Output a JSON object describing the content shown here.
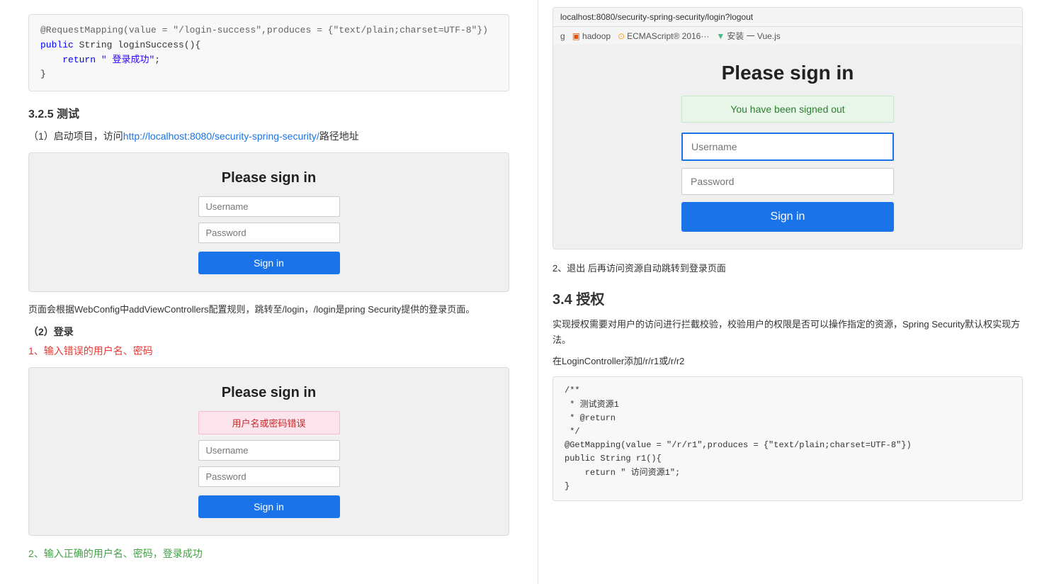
{
  "left": {
    "code_block_1": {
      "line1": "@RequestMapping(value = \"/login-success\",produces = {\"text/plain;charset=UTF-8\"})",
      "line2": "public String loginSuccess(){",
      "line3": "    return \" 登录成功\";",
      "line4": "}"
    },
    "section_325": "3.2.5 测试",
    "para1_prefix": "（1）启动项目，访问",
    "para1_link": "http://localhost:8080/security-spring-security/",
    "para1_suffix": "路径地址",
    "login_box_1": {
      "title": "Please sign in",
      "username_placeholder": "Username",
      "password_placeholder": "Password",
      "sign_in_btn": "Sign in"
    },
    "note_1": "页面会根据WebConfig中addViewControllers配置规则，跳转至/login，/login是pring Security提供的登录页面。",
    "sub_label_2": "（2）登录",
    "red_label_1": "1、输入错误的用户名、密码",
    "login_box_2": {
      "title": "Please sign in",
      "error_msg": "用户名或密码错误",
      "username_placeholder": "Username",
      "password_placeholder": "Password",
      "sign_in_btn": "Sign in"
    },
    "green_label_bottom": "2、输入正确的用户名、密码，登录成功"
  },
  "right": {
    "browser_url": "localhost:8080/security-spring-security/login?logout",
    "bookmarks": [
      "g",
      "hadoop",
      "ECMAScript® 2016···",
      "安装 一 Vue.js"
    ],
    "browser_login": {
      "title": "Please sign in",
      "signed_out_msg": "You have been signed out",
      "username_placeholder": "Username",
      "password_placeholder": "Password",
      "sign_in_btn": "Sign in"
    },
    "note_2": "2、退出 后再访问资源自动跳转到登录页面",
    "section_34": "3.4 授权",
    "para_auth": "实现授权需要对用户的访问进行拦截校验，校验用户的权限是否可以操作指定的资源，Spring Security默认权实现方法。",
    "para_login_ctrl": "在LoginController添加/r/r1或/r/r2",
    "code_block_auth": {
      "lines": [
        "/**",
        " * 测试资源1",
        " * @return",
        " */",
        "@GetMapping(value = \"/r/r1\",produces = {\"text/plain;charset=UTF-8\"})",
        "public String r1(){",
        "    return \" 访问资源1\";",
        "}"
      ]
    }
  }
}
